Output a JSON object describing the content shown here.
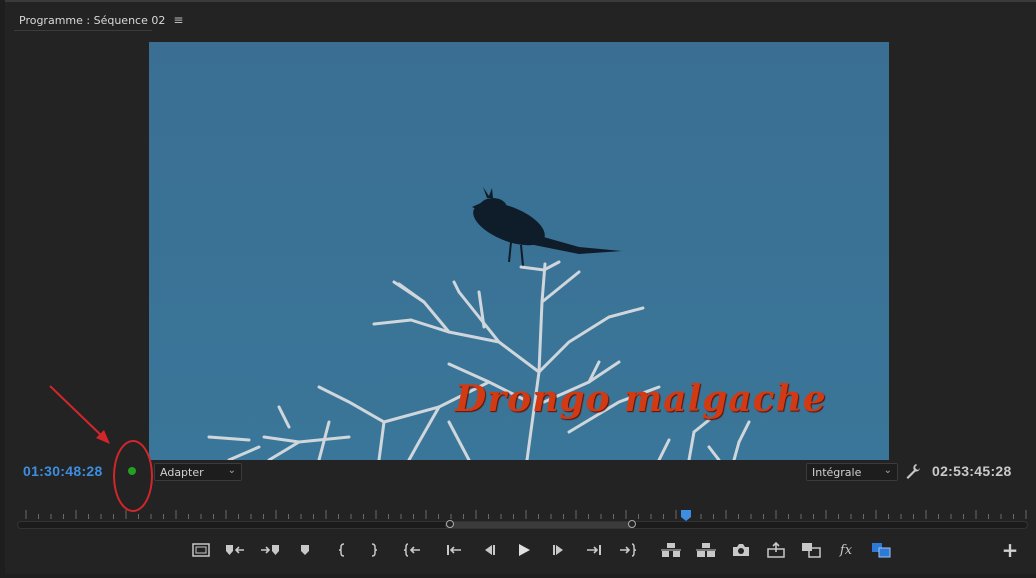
{
  "panel": {
    "title": "Programme : Séquence 02"
  },
  "video": {
    "title_overlay": "Drongo malgache"
  },
  "timecode": {
    "current": "01:30:48:28",
    "duration": "02:53:45:28"
  },
  "zoom_select": {
    "value": "Adapter"
  },
  "quality_select": {
    "value": "Intégrale"
  },
  "colors": {
    "accent": "#3d8ee0",
    "status_dot": "#22a020",
    "annotation": "#d2262b",
    "title_text": "#d23a14",
    "sky": "#3a7296"
  },
  "toolbar": {
    "buttons": [
      "safe-margins-icon",
      "mark-in-icon",
      "mark-out-icon",
      "add-marker-icon",
      "mark-in-bracket-icon",
      "mark-out-bracket-icon",
      "go-to-in-icon",
      "step-to-start-icon",
      "step-back-icon",
      "play-icon",
      "step-forward-icon",
      "step-to-end-icon",
      "go-to-out-icon",
      "lift-icon",
      "extract-icon",
      "export-frame-icon",
      "insert-icon",
      "overlay-icon",
      "fx-icon",
      "comparison-view-icon",
      "add-button-icon"
    ],
    "fx_label": "fx",
    "add_label": "+"
  }
}
